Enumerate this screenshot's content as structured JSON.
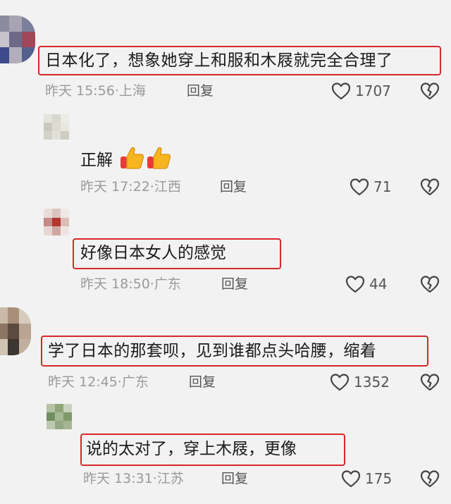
{
  "comments": [
    {
      "text": "日本化了，想象她穿上和服和木屐就完全合理了",
      "time": "昨天 15:56",
      "location": "上海",
      "reply_label": "回复",
      "likes": "1707",
      "avatar_colors": [
        "#8c8a9e",
        "#a7a3b2",
        "#7b7e9c",
        "#c7c2cb",
        "#6d6a88",
        "#a2465a",
        "#3d4b8c",
        "#b3aebb",
        "#53608e"
      ]
    },
    {
      "text": "正解",
      "emoji": [
        "thumbs-up-emoji",
        "thumbs-up-emoji"
      ],
      "time": "昨天 17:22",
      "location": "江西",
      "reply_label": "回复",
      "likes": "71",
      "avatar_colors": [
        "#e4e4dc",
        "#d9d8cf",
        "#ecece6",
        "#c9c8bd",
        "#dedcd2",
        "#e8e7e0",
        "#d3d2c9",
        "#e1e0d8",
        "#cfcdc3"
      ]
    },
    {
      "text": "好像日本女人的感觉",
      "time": "昨天 18:50",
      "location": "广东",
      "reply_label": "回复",
      "likes": "44",
      "avatar_colors": [
        "#e9dcd9",
        "#d9c4c1",
        "#f0e8e6",
        "#c58a86",
        "#b5352f",
        "#dcbcb7",
        "#e6d6d3",
        "#cfa8a3",
        "#efe4e2"
      ]
    },
    {
      "text": "学了日本的那套呗，见到谁都点头哈腰，缩着",
      "time": "昨天 12:45",
      "location": "广东",
      "reply_label": "回复",
      "likes": "1352",
      "avatar_colors": [
        "#c9b9a7",
        "#a88f7a",
        "#d8ccbf",
        "#8d7563",
        "#5c4a3f",
        "#b9a391",
        "#d2c3b3",
        "#3d3530",
        "#c2b09e"
      ]
    },
    {
      "text": "说的太对了，穿上木屐，更像",
      "time": "昨天 13:31",
      "location": "江苏",
      "reply_label": "回复",
      "likes": "175",
      "avatar_colors": [
        "#b5c2a6",
        "#8ea679",
        "#c9d2bc",
        "#6f8f5e",
        "#a7b896",
        "#7d9a69",
        "#bdc8b0",
        "#93a985",
        "#a3b592"
      ]
    }
  ],
  "icons": {
    "like": "heart-outline-icon",
    "dislike": "heart-broken-icon"
  },
  "highlight_color": "#d82828"
}
